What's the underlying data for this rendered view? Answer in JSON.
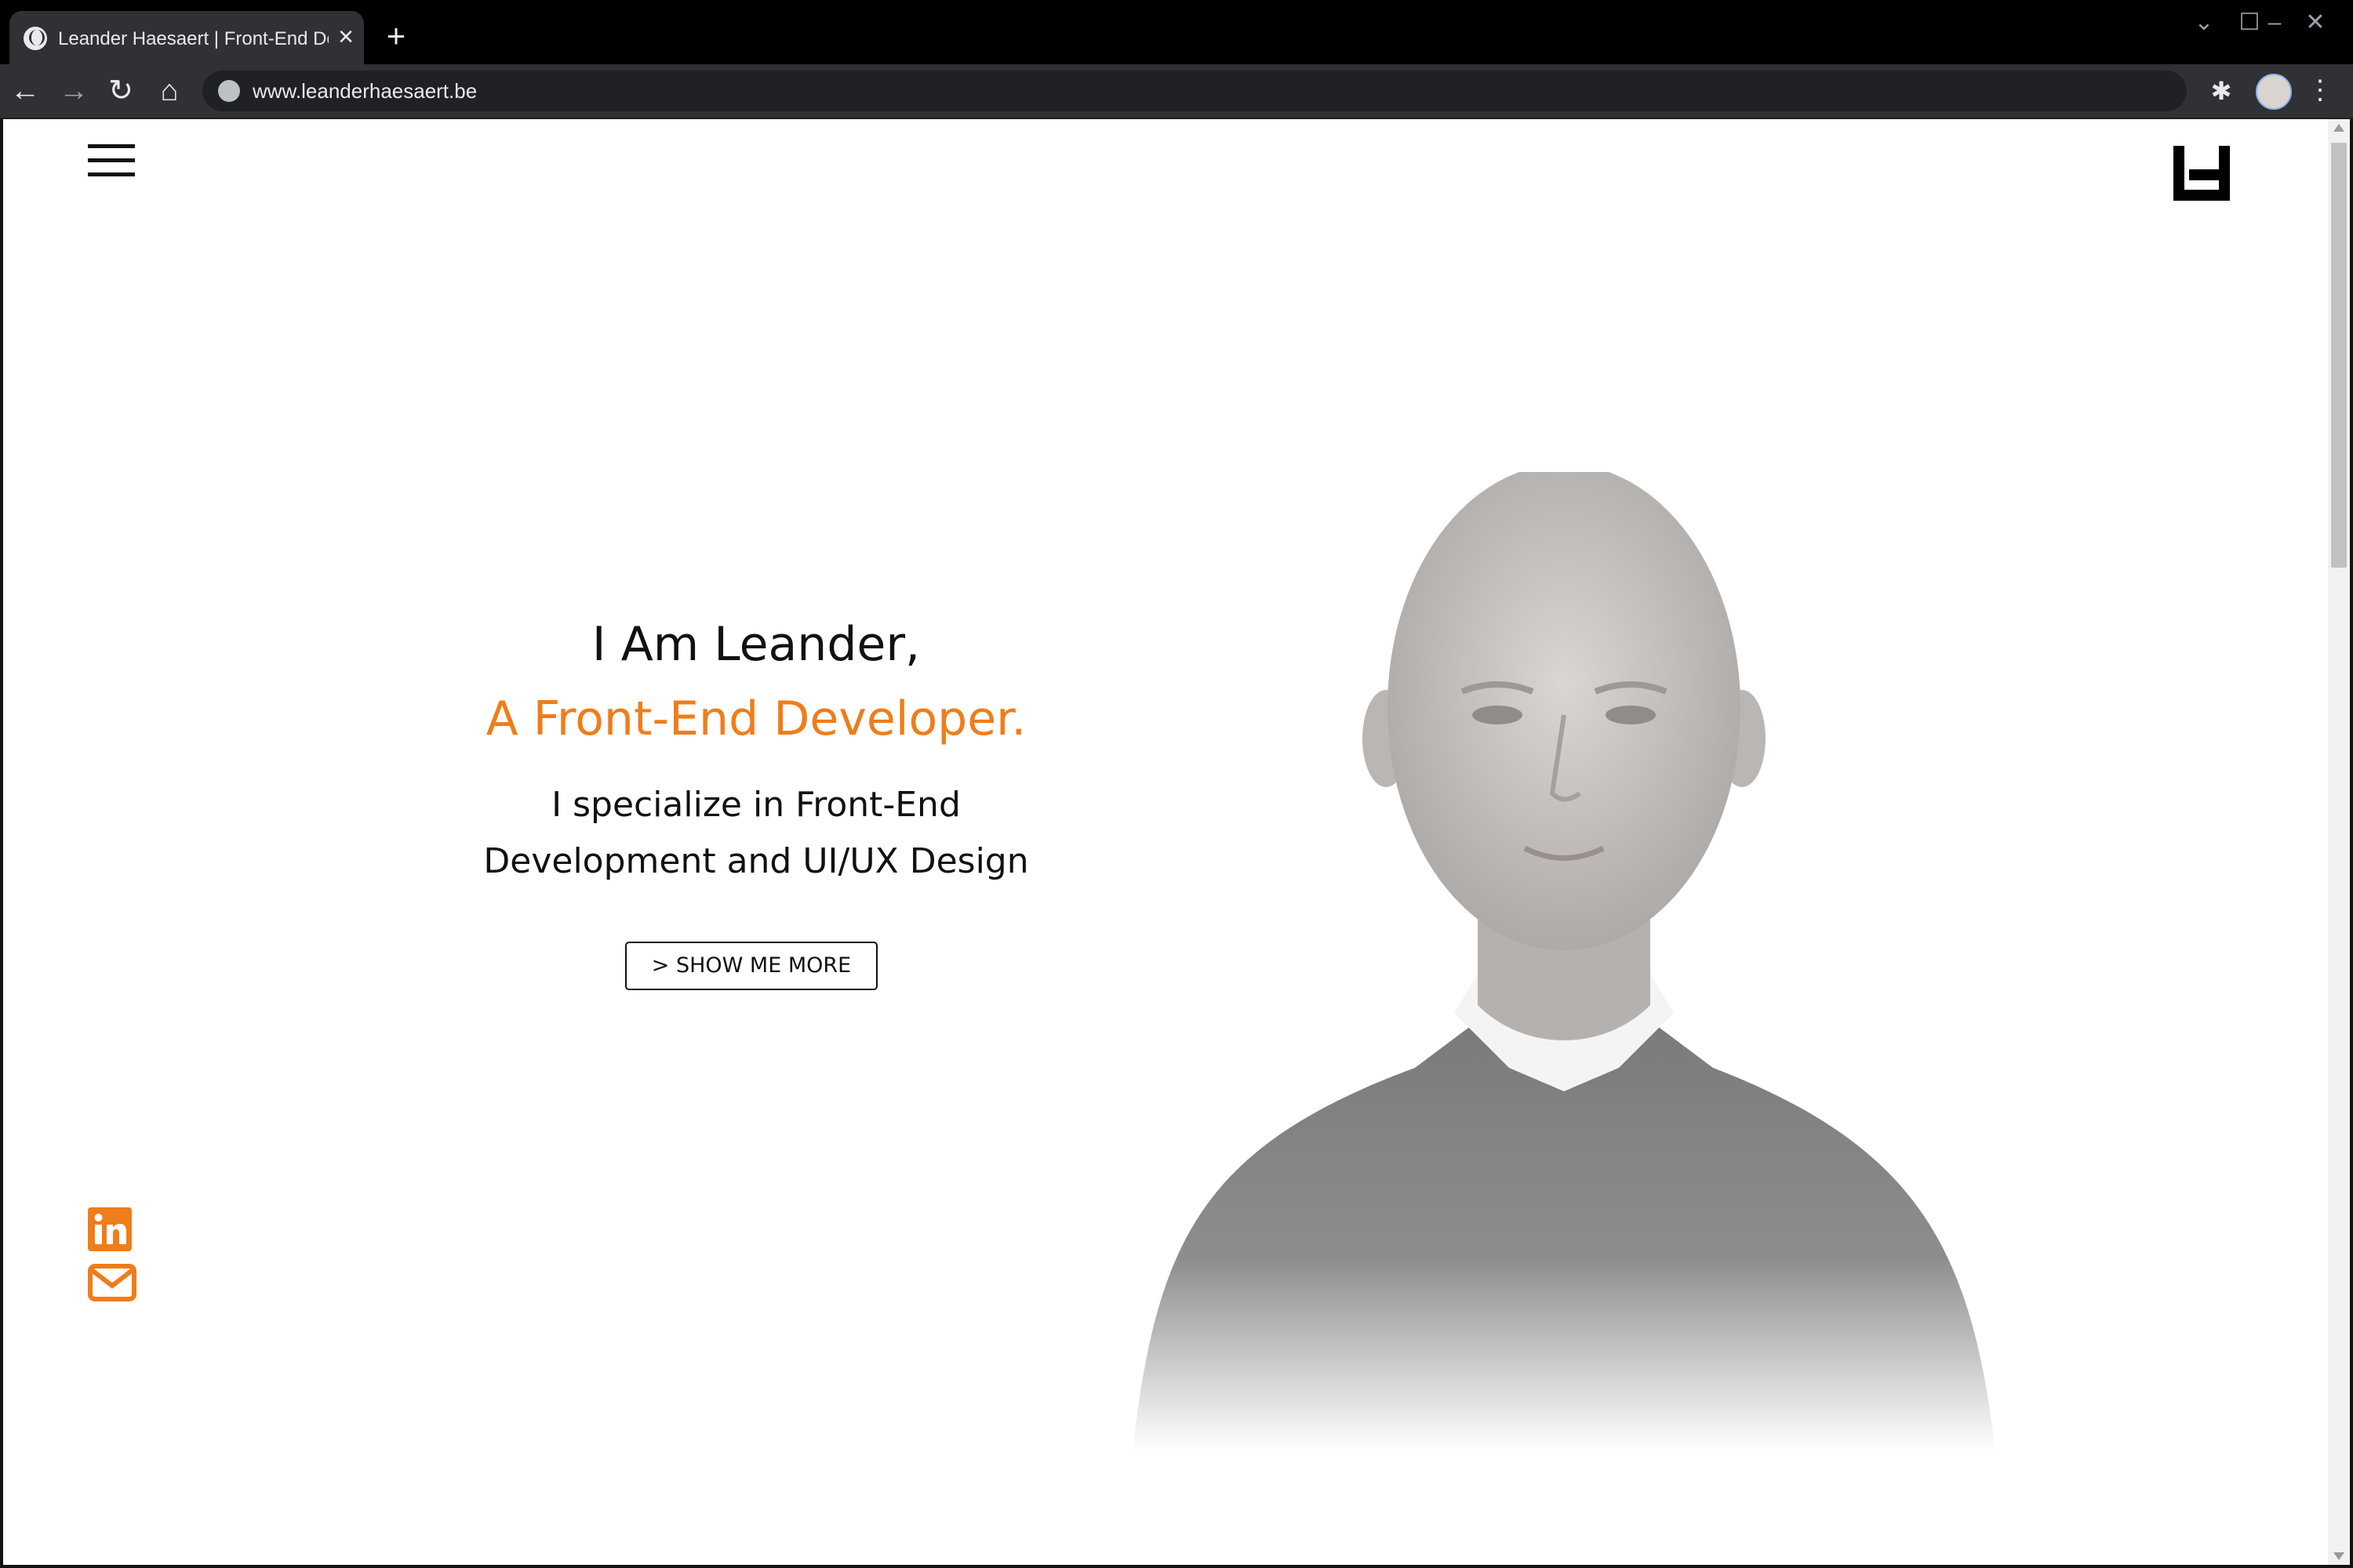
{
  "browser": {
    "tab_title": "Leander Haesaert | Front-End Developer",
    "tab_close_icon": "×",
    "new_tab_icon": "+",
    "url": "www.leanderhaesaert.be",
    "icons": {
      "back": "←",
      "forward": "→",
      "reload": "↻",
      "home": "⌂",
      "extensions": "✱",
      "menu": "⋮",
      "tab_search": "⌄",
      "minimize": "–",
      "maximize": "☐",
      "close": "✕"
    }
  },
  "page": {
    "heading_line1": "I Am Leander,",
    "heading_line2": "A Front-End Developer.",
    "subtitle": "I specialize in Front-End Development and UI/UX Design",
    "cta_label": "> SHOW ME MORE",
    "accent_color": "#ef7d1a",
    "social": [
      "linkedin-icon",
      "email-icon"
    ]
  }
}
